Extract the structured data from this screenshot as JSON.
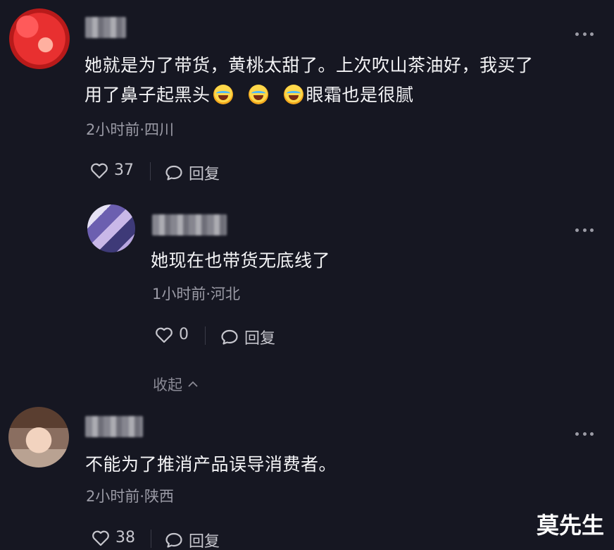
{
  "comments": [
    {
      "text_line1": "她就是为了带货，黄桃太甜了。上次吹山茶油好，我买了",
      "text_line2_part1": "用了鼻子起黑头",
      "text_line2_part2": "眼霜也是很腻",
      "meta": "2小时前·四川",
      "likes": "37",
      "reply_label": "回复"
    },
    {
      "text": "她现在也带货无底线了",
      "meta": "1小时前·河北",
      "likes": "0",
      "reply_label": "回复",
      "collapse_label": "收起"
    },
    {
      "text": "不能为了推消产品误导消费者。",
      "meta": "2小时前·陕西",
      "likes": "38",
      "reply_label": "回复"
    }
  ],
  "watermark": "莫先生",
  "icons": {
    "more": "more-dots-icon",
    "like": "heart-outline-icon",
    "reply": "speech-bubble-icon",
    "emoji": "rolling-on-floor-laughing-emoji",
    "collapse": "chevron-up-icon"
  },
  "colors": {
    "background": "#161722",
    "text": "#f4f4f6",
    "meta": "#9b9ba6"
  }
}
